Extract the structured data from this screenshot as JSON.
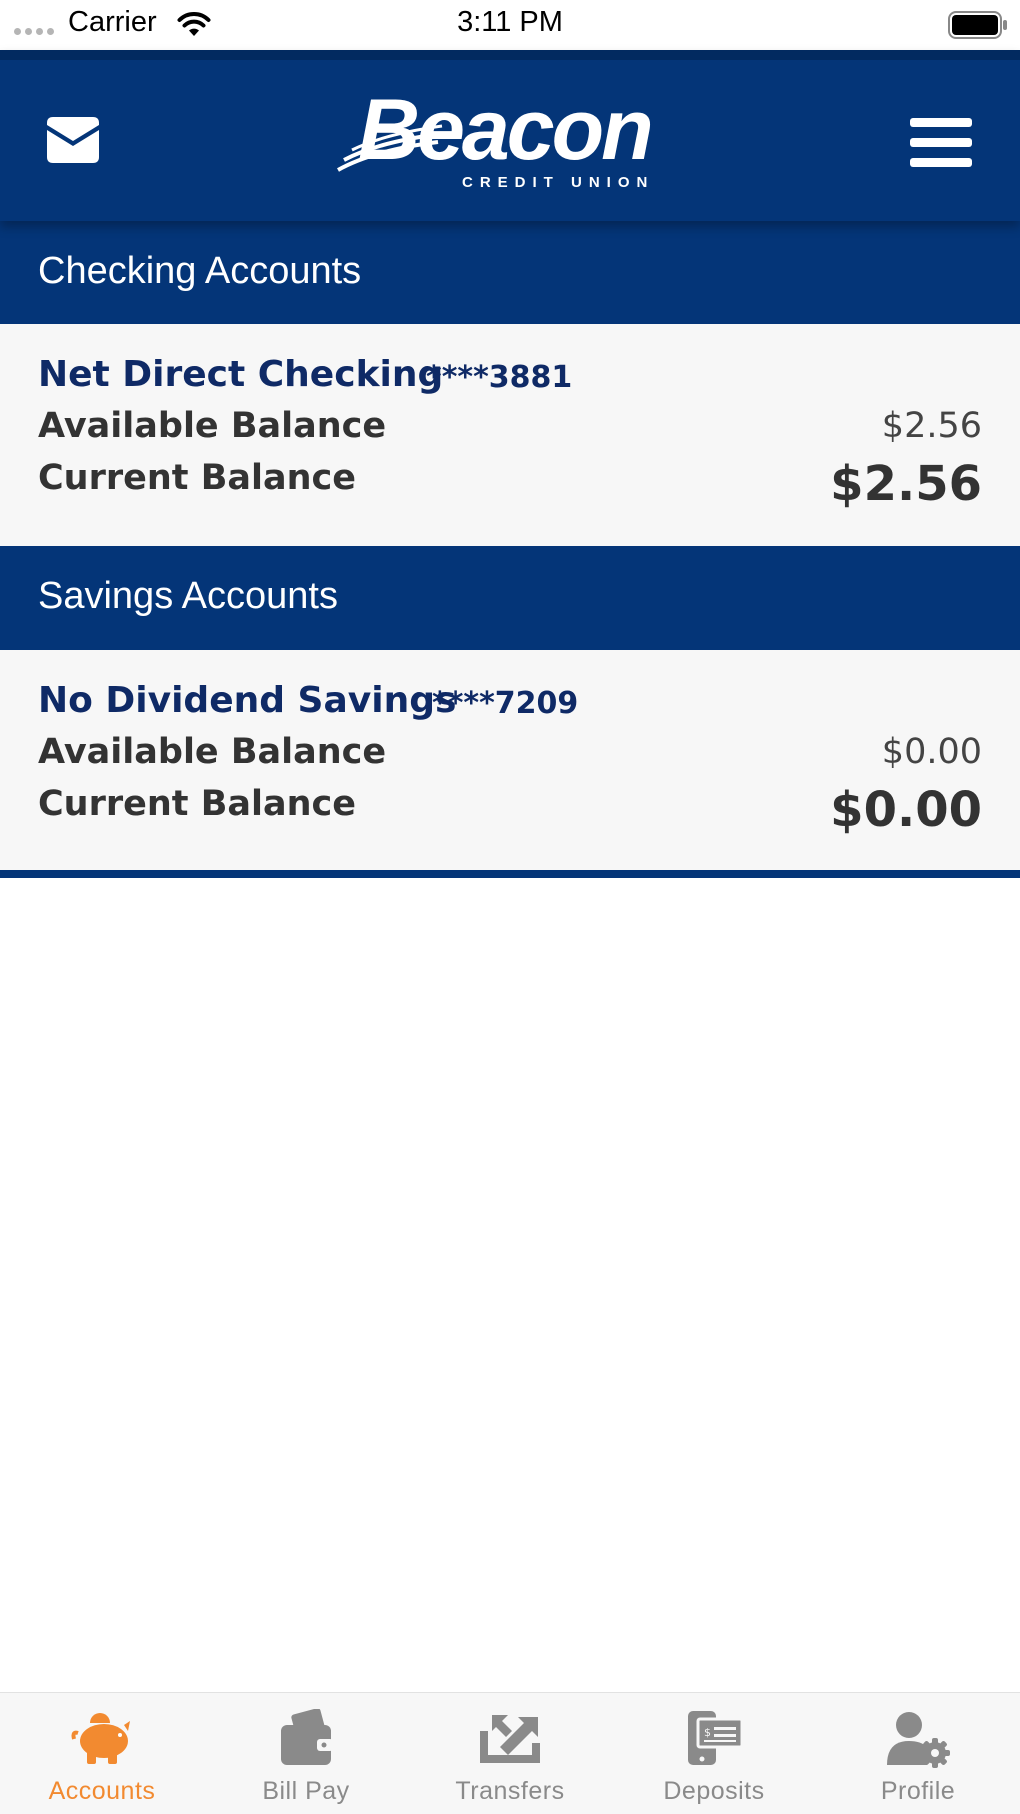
{
  "status_bar": {
    "carrier": "Carrier",
    "time": "3:11 PM"
  },
  "header": {
    "logo_text": "Beacon",
    "logo_subtext": "CREDIT UNION",
    "left_icon": "mail-icon",
    "right_icon": "hamburger-menu-icon"
  },
  "sections": [
    {
      "title": "Checking Accounts",
      "accounts": [
        {
          "name": "Net Direct Checking",
          "number": "****3881",
          "available_label": "Available Balance",
          "available_value": "$2.56",
          "current_label": "Current Balance",
          "current_value": "$2.56"
        }
      ]
    },
    {
      "title": "Savings Accounts",
      "accounts": [
        {
          "name": "No Dividend Savings",
          "number": "****7209",
          "available_label": "Available Balance",
          "available_value": "$0.00",
          "current_label": "Current Balance",
          "current_value": "$0.00"
        }
      ]
    }
  ],
  "tabs": [
    {
      "label": "Accounts",
      "icon": "piggy-bank-icon",
      "active": true
    },
    {
      "label": "Bill Pay",
      "icon": "wallet-icon",
      "active": false
    },
    {
      "label": "Transfers",
      "icon": "transfer-arrows-icon",
      "active": false
    },
    {
      "label": "Deposits",
      "icon": "mobile-check-deposit-icon",
      "active": false
    },
    {
      "label": "Profile",
      "icon": "user-settings-icon",
      "active": false
    }
  ],
  "colors": {
    "brand_navy": "#043578",
    "account_text": "#0f2a66",
    "active_tab": "#f28a30",
    "inactive_tab": "#8a8a8a"
  }
}
